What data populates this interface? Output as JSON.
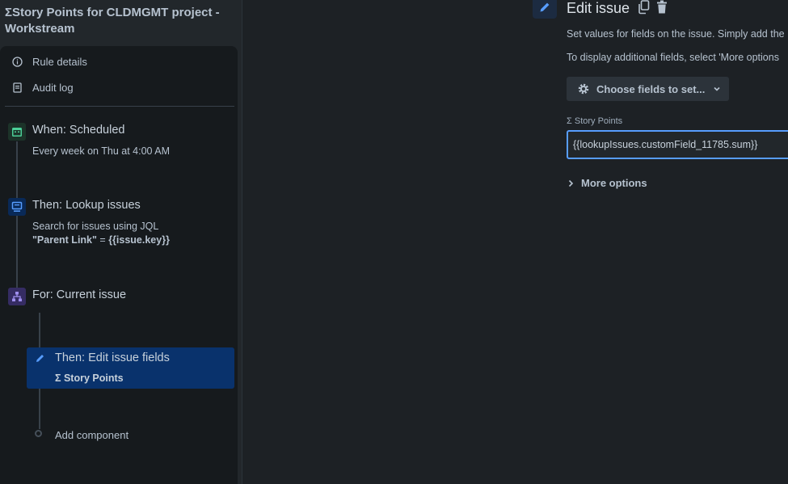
{
  "rule": {
    "title": "ΣStory Points for CLDMGMT project - Workstream"
  },
  "nav": {
    "rule_details": "Rule details",
    "audit_log": "Audit log"
  },
  "steps": {
    "trigger": {
      "title": "When: Scheduled",
      "subtitle": "Every week on Thu at 4:00 AM"
    },
    "lookup": {
      "title": "Then: Lookup issues",
      "line1": "Search for issues using JQL",
      "jql_field": "\"Parent Link\"",
      "jql_op": " = ",
      "jql_value": "{{issue.key}}"
    },
    "branch": {
      "title": "For: Current issue"
    },
    "edit": {
      "title": "Then: Edit issue fields",
      "subtitle": "Σ Story Points"
    },
    "add_component": "Add component"
  },
  "editor": {
    "title": "Edit issue",
    "desc1": "Set values for fields on the issue. Simply add the",
    "desc2": "To display additional fields, select 'More options",
    "choose_fields": "Choose fields to set...",
    "field_label": "Σ Story Points",
    "field_value": "{{lookupIssues.customField_11785.sum}}",
    "more_options": "More options"
  },
  "colors": {
    "accent": "#579dff",
    "selected": "#09326c",
    "trigger": "#1f845a",
    "lookup": "#0055cc",
    "branch": "#5e4db2"
  }
}
